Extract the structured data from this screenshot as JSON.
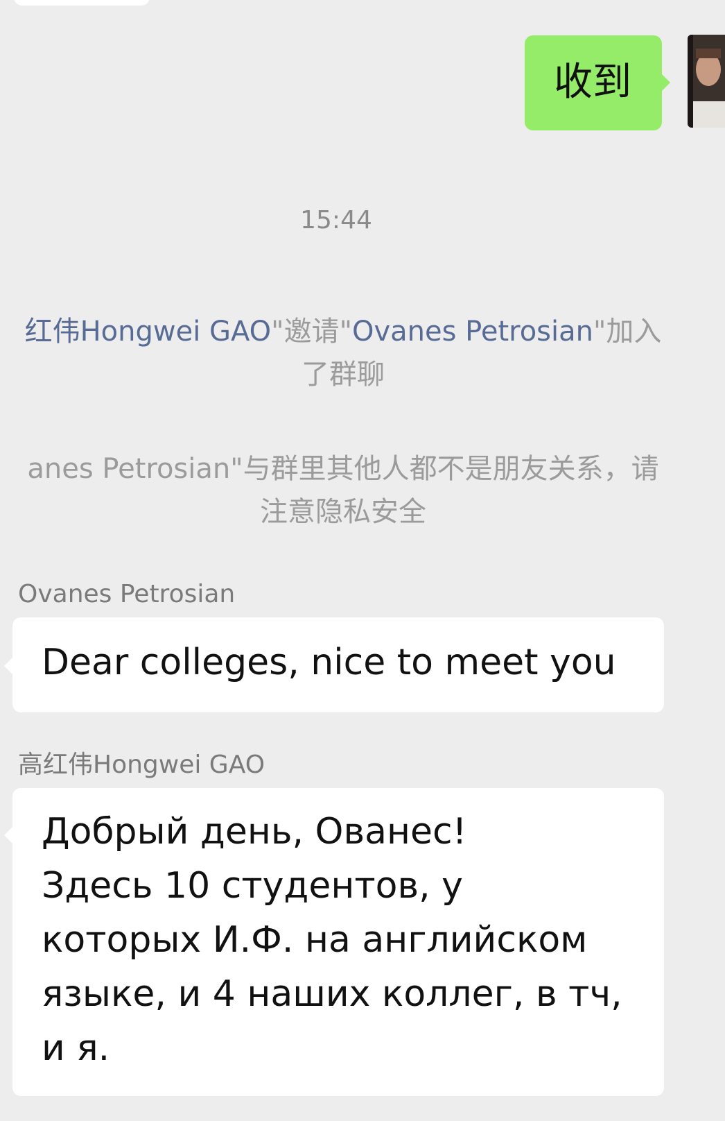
{
  "chat": {
    "partial_top_bubble": "",
    "my_message": {
      "text": "收到"
    },
    "timestamp": "15:44",
    "system_invite": {
      "line1_prefix": "红伟Hongwei GAO",
      "line1_mid1": "\"邀请\"",
      "line1_link2": "Ovanes Petrosian",
      "line1_suffix": "\"加入",
      "line2": "了群聊"
    },
    "system_privacy": {
      "line1": "anes Petrosian\"与群里其他人都不是朋友关系，请",
      "line2": "注意隐私安全"
    },
    "messages": [
      {
        "sender": "Ovanes Petrosian",
        "lines": [
          "Dear colleges, nice to meet you"
        ]
      },
      {
        "sender": "高红伟Hongwei GAO",
        "lines": [
          "Добрый день, Ованес!",
          "Здесь 10 студентов, у",
          "которых И.Ф. на английском",
          "языке, и 4 наших коллег, в тч,",
          "и я."
        ]
      }
    ]
  },
  "colors": {
    "background": "#ededed",
    "incoming_bubble": "#ffffff",
    "outgoing_bubble": "#95ec69",
    "link": "#576b95",
    "system_text": "#9b9b9b"
  },
  "icons": {
    "avatar": "user-avatar-photo"
  }
}
